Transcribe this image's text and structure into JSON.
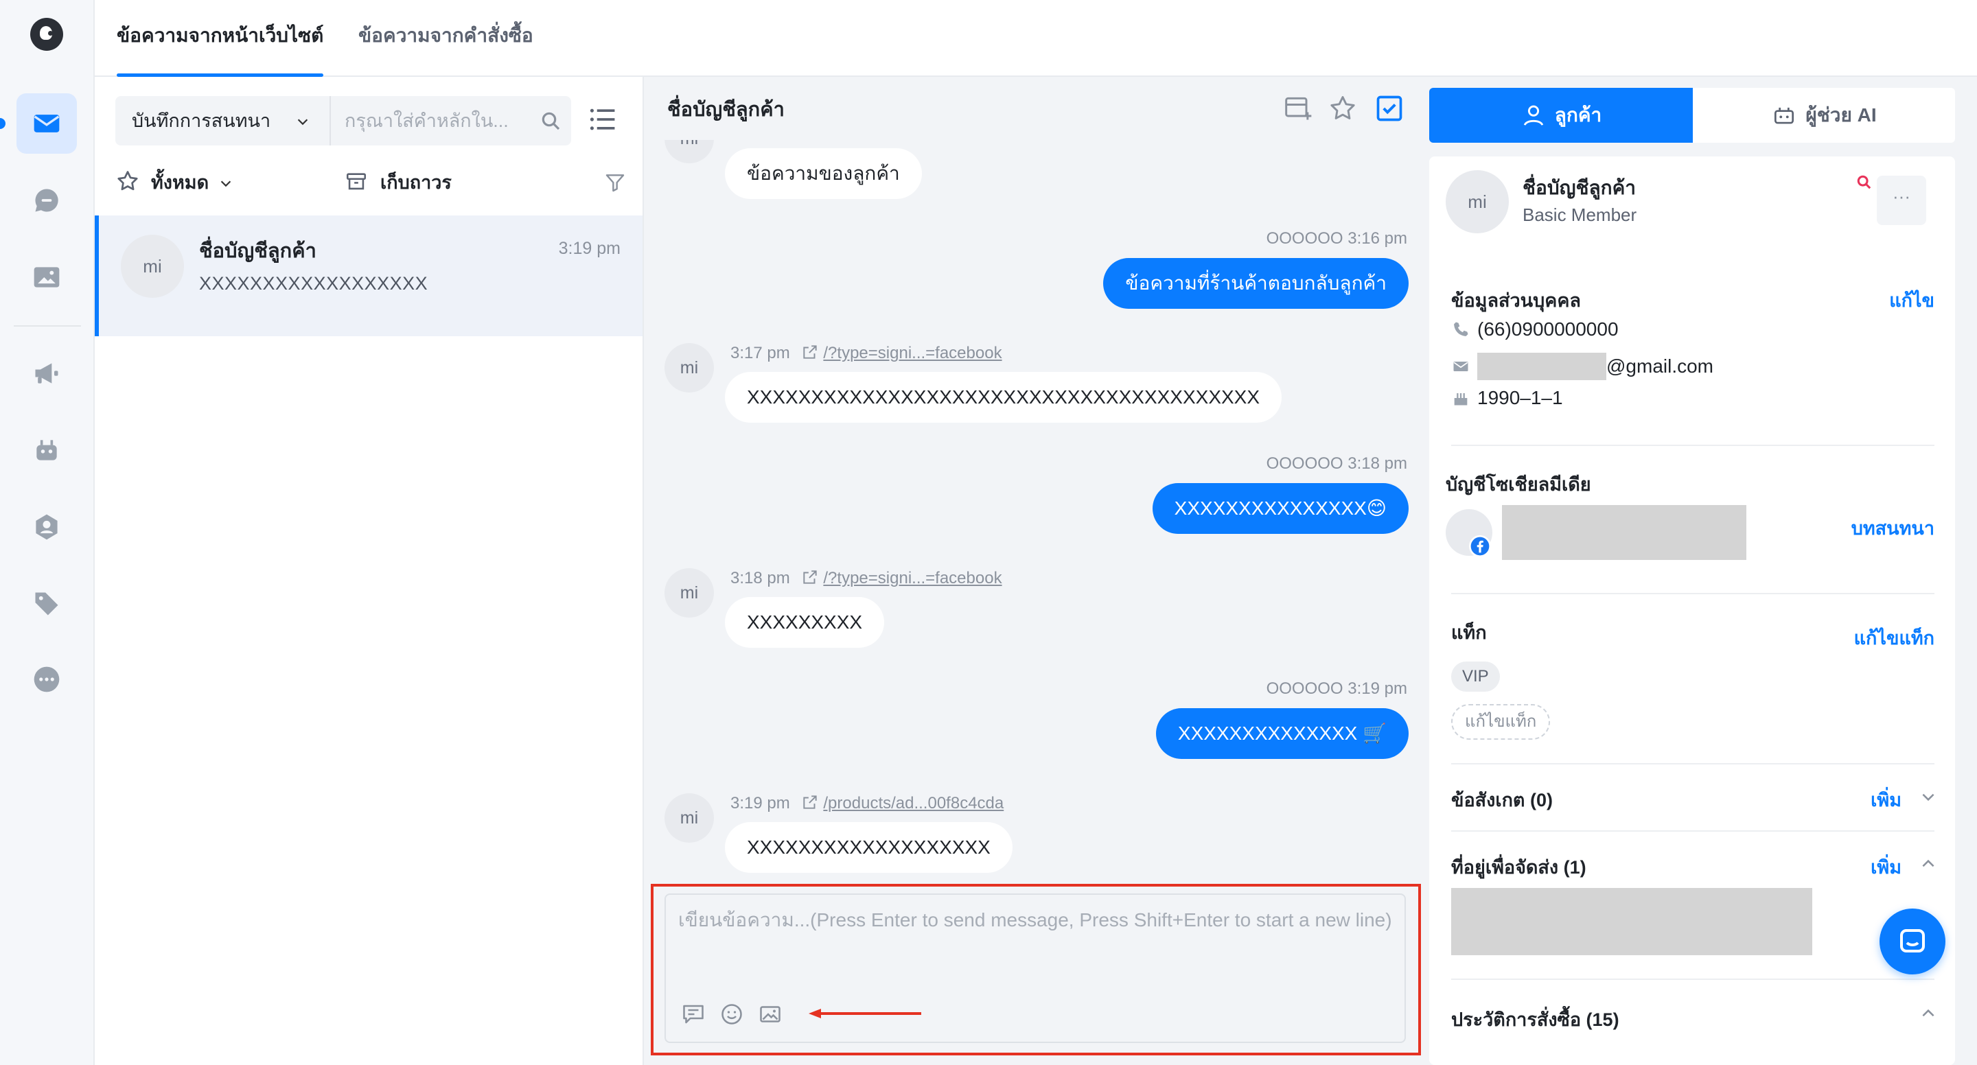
{
  "top_tabs": [
    {
      "label": "ข้อความจากหน้าเว็บไซต์",
      "active": true
    },
    {
      "label": "ข้อความจากคำสั่งซื้อ",
      "active": false
    }
  ],
  "rail": {
    "items": [
      "inbox-icon",
      "chat-icon",
      "image-icon",
      "megaphone-icon",
      "robot-icon",
      "contact-icon",
      "tag-icon",
      "more-icon"
    ]
  },
  "list": {
    "filter_select": "บันทึกการสนทนา",
    "search_placeholder": "กรุณาใส่คำหลักใน...",
    "all_label": "ทั้งหมด",
    "archive_label": "เก็บถาวร",
    "conversations": [
      {
        "avatar": "mi",
        "name": "ชื่อบัญชีลูกค้า",
        "time": "3:19 pm",
        "preview": "XXXXXXXXXXXXXXXXXX"
      }
    ]
  },
  "chat": {
    "title": "ชื่อบัญชีลูกค้า",
    "avatar": "mi",
    "messages": [
      {
        "dir": "in",
        "text": "ข้อความของลูกค้า"
      },
      {
        "dir": "out",
        "name": "OOOOOO",
        "time": "3:16 pm",
        "text": "ข้อความที่ร้านค้าตอบกลับลูกค้า"
      },
      {
        "dir": "in",
        "time": "3:17 pm",
        "link": "/?type=signi...=facebook",
        "text": "XXXXXXXXXXXXXXXXXXXXXXXXXXXXXXXXXXXXXXXX"
      },
      {
        "dir": "out",
        "name": "OOOOOO",
        "time": "3:18 pm",
        "text": "XXXXXXXXXXXXXXX😊"
      },
      {
        "dir": "in",
        "time": "3:18 pm",
        "link": "/?type=signi...=facebook",
        "text": "XXXXXXXXX"
      },
      {
        "dir": "out",
        "name": "OOOOOO",
        "time": "3:19 pm",
        "text": "XXXXXXXXXXXXXX 🛒"
      },
      {
        "dir": "in",
        "time": "3:19 pm",
        "link": "/products/ad...00f8c4cda",
        "text": "XXXXXXXXXXXXXXXXXXX"
      }
    ],
    "composer_placeholder": "เขียนข้อความ...(Press Enter to send message, Press Shift+Enter to start a new line)"
  },
  "customer": {
    "tabs": [
      {
        "label": "ลูกค้า",
        "active": true
      },
      {
        "label": "ผู้ช่วย AI",
        "active": false
      }
    ],
    "avatar": "mi",
    "name": "ชื่อบัญชีลูกค้า",
    "member": "Basic Member",
    "more": "···",
    "personal": {
      "title": "ข้อมูลส่วนบุคคล",
      "edit": "แก้ไข",
      "phone": "(66)0900000000",
      "email_suffix": "@gmail.com",
      "birthday": "1990–1–1"
    },
    "social": {
      "title": "บัญชีโซเชียลมีเดีย",
      "link": "บทสนทนา"
    },
    "tags": {
      "title": "แท็ก",
      "edit": "แก้ไขแท็ก",
      "items": [
        "VIP"
      ],
      "add": "แก้ไขแท็ก"
    },
    "notes": {
      "title": "ข้อสังเกต (0)",
      "add": "เพิ่ม"
    },
    "address": {
      "title": "ที่อยู่เพื่อจัดส่ง (1)",
      "add": "เพิ่ม"
    },
    "orders": {
      "title": "ประวัติการสั่งซื้อ (15)"
    }
  },
  "colors": {
    "accent": "#0a7cff",
    "highlight_box": "#e53222",
    "arrow": "#e53222"
  }
}
